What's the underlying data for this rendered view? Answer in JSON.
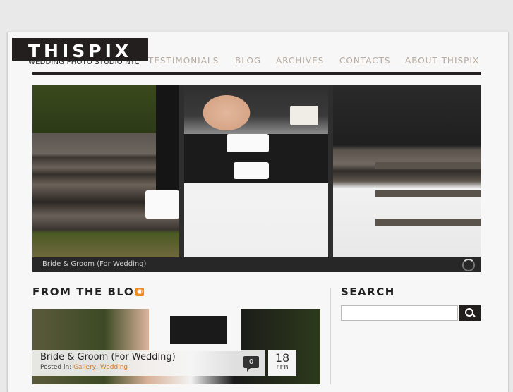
{
  "site": {
    "logo": "THISPIX",
    "tagline": "WEDDING PHOTO STUDIO NYC"
  },
  "nav": {
    "items": [
      {
        "label": "TESTIMONIALS"
      },
      {
        "label": "BLOG"
      },
      {
        "label": "ARCHIVES"
      },
      {
        "label": "CONTACTS"
      },
      {
        "label": "ABOUT THISPIX"
      }
    ]
  },
  "slider": {
    "caption": "Bride & Groom (For Wedding)"
  },
  "blog": {
    "heading": "FROM THE BLOG",
    "rss_icon": "rss-icon",
    "post": {
      "title": "Bride & Groom (For Wedding)",
      "posted_in_label": "Posted in:",
      "categories": [
        "Gallery",
        "Wedding"
      ],
      "separator": ",",
      "comments": "0",
      "day": "18",
      "month": "FEB"
    }
  },
  "search": {
    "heading": "SEARCH",
    "placeholder": "",
    "button_icon": "search-icon"
  },
  "colors": {
    "accent": "#d07b28",
    "dark": "#231f1f",
    "nav_text": "#b8aba0"
  }
}
